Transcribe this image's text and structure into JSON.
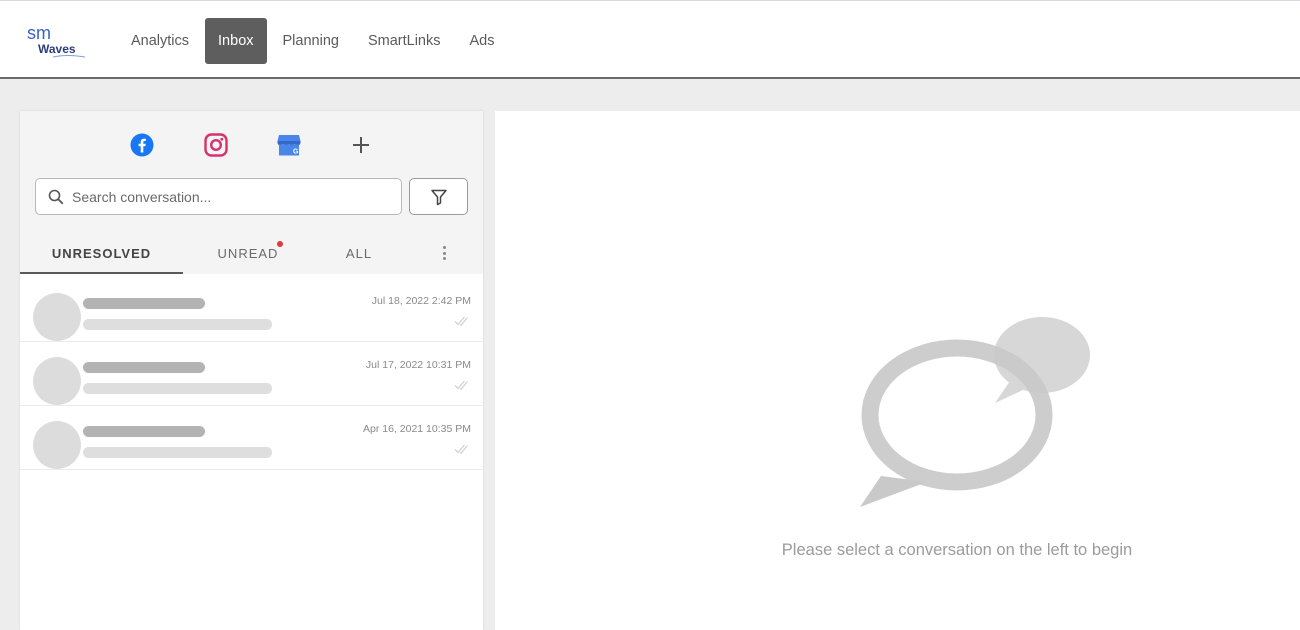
{
  "header": {
    "logo_text_top": "sm",
    "logo_text_bottom": "Waves",
    "nav": [
      {
        "label": "Analytics",
        "active": false
      },
      {
        "label": "Inbox",
        "active": true
      },
      {
        "label": "Planning",
        "active": false
      },
      {
        "label": "SmartLinks",
        "active": false
      },
      {
        "label": "Ads",
        "active": false
      }
    ]
  },
  "channels": [
    "facebook-icon",
    "instagram-icon",
    "google-business-icon",
    "plus-icon"
  ],
  "search": {
    "placeholder": "Search conversation..."
  },
  "tabs": [
    {
      "label": "UNRESOLVED",
      "active": true
    },
    {
      "label": "UNREAD",
      "active": false,
      "has_dot": true
    },
    {
      "label": "ALL",
      "active": false
    }
  ],
  "conversations": [
    {
      "date": "Jul 18, 2022 2:42 PM"
    },
    {
      "date": "Jul 17, 2022 10:31 PM"
    },
    {
      "date": "Apr 16, 2021 10:35 PM"
    }
  ],
  "empty_state": {
    "message": "Please select a conversation on the left to begin"
  },
  "colors": {
    "active_nav_bg": "#5e5e5e",
    "facebook": "#1877f2",
    "instagram": "#d6336c",
    "google_business": "#4a86e8",
    "unread_dot": "#e03a3a"
  }
}
